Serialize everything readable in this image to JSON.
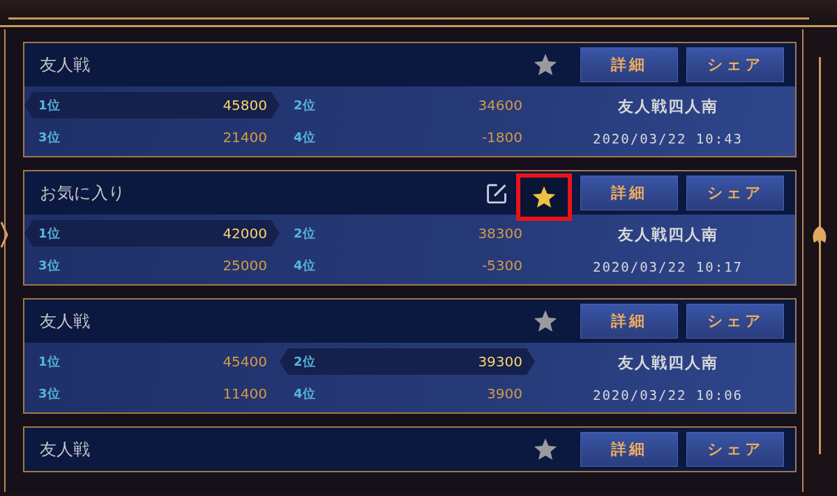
{
  "records": [
    {
      "title": "友人戦",
      "editable": false,
      "favorite": false,
      "marked": false,
      "buttons": [
        "詳細",
        "シェア"
      ],
      "ranks": [
        {
          "rank": "1位",
          "score": "45800",
          "highlighted": true
        },
        {
          "rank": "2位",
          "score": "34600",
          "highlighted": false
        },
        {
          "rank": "3位",
          "score": "21400",
          "highlighted": false
        },
        {
          "rank": "4位",
          "score": "-1800",
          "highlighted": false
        }
      ],
      "mode": "友人戦四人南",
      "datetime": "2020/03/22 10:43"
    },
    {
      "title": "お気に入り",
      "editable": true,
      "favorite": true,
      "marked": true,
      "buttons": [
        "詳細",
        "シェア"
      ],
      "ranks": [
        {
          "rank": "1位",
          "score": "42000",
          "highlighted": true
        },
        {
          "rank": "2位",
          "score": "38300",
          "highlighted": false
        },
        {
          "rank": "3位",
          "score": "25000",
          "highlighted": false
        },
        {
          "rank": "4位",
          "score": "-5300",
          "highlighted": false
        }
      ],
      "mode": "友人戦四人南",
      "datetime": "2020/03/22 10:17"
    },
    {
      "title": "友人戦",
      "editable": false,
      "favorite": false,
      "marked": false,
      "buttons": [
        "詳細",
        "シェア"
      ],
      "ranks": [
        {
          "rank": "1位",
          "score": "45400",
          "highlighted": false
        },
        {
          "rank": "2位",
          "score": "39300",
          "highlighted": true
        },
        {
          "rank": "3位",
          "score": "11400",
          "highlighted": false
        },
        {
          "rank": "4位",
          "score": "3900",
          "highlighted": false
        }
      ],
      "mode": "友人戦四人南",
      "datetime": "2020/03/22 10:06"
    },
    {
      "title": "友人戦",
      "editable": false,
      "favorite": false,
      "marked": false,
      "buttons": [
        "詳細",
        "シェア"
      ]
    }
  ]
}
